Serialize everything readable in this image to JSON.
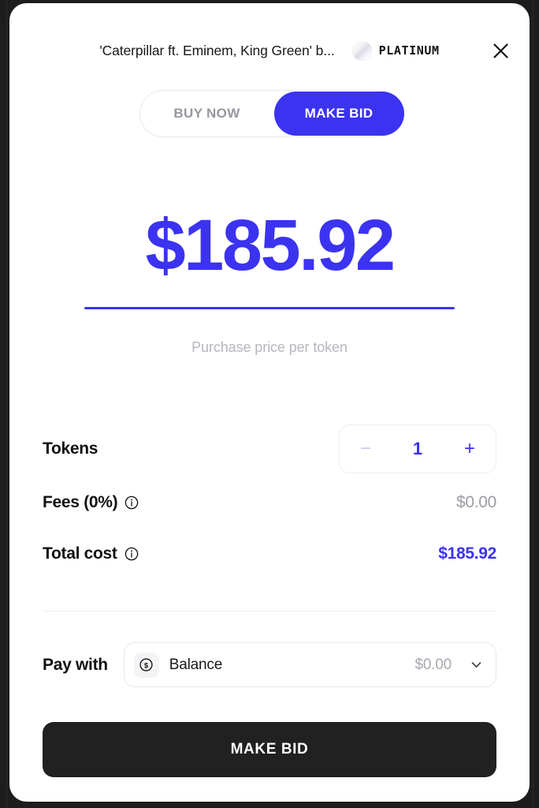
{
  "header": {
    "title": "'Caterpillar ft. Eminem, King Green' b...",
    "tier_label": "PLATINUM",
    "tier_icon": "platinum-orb-icon",
    "close_icon": "close-icon"
  },
  "mode_toggle": {
    "buy_now_label": "BUY NOW",
    "make_bid_label": "MAKE BID",
    "selected": "MAKE BID"
  },
  "price": {
    "value": "$185.92",
    "caption": "Purchase price per token"
  },
  "summary": {
    "tokens": {
      "label": "Tokens",
      "minus_label": "−",
      "quantity": "1",
      "plus_label": "+"
    },
    "fees": {
      "label": "Fees (0%)",
      "info_icon": "info-icon",
      "value": "$0.00"
    },
    "total": {
      "label": "Total cost",
      "info_icon": "info-icon",
      "value": "$185.92"
    }
  },
  "pay_with": {
    "label": "Pay with",
    "method_icon": "dollar-circle-icon",
    "method_name": "Balance",
    "method_amount": "$0.00",
    "chevron_icon": "chevron-down-icon"
  },
  "cta": {
    "label": "MAKE BID"
  },
  "colors": {
    "accent": "#3b33f0",
    "cta_background": "#212121",
    "muted_text": "#9d9da5",
    "backdrop": "#1d1d1d"
  }
}
